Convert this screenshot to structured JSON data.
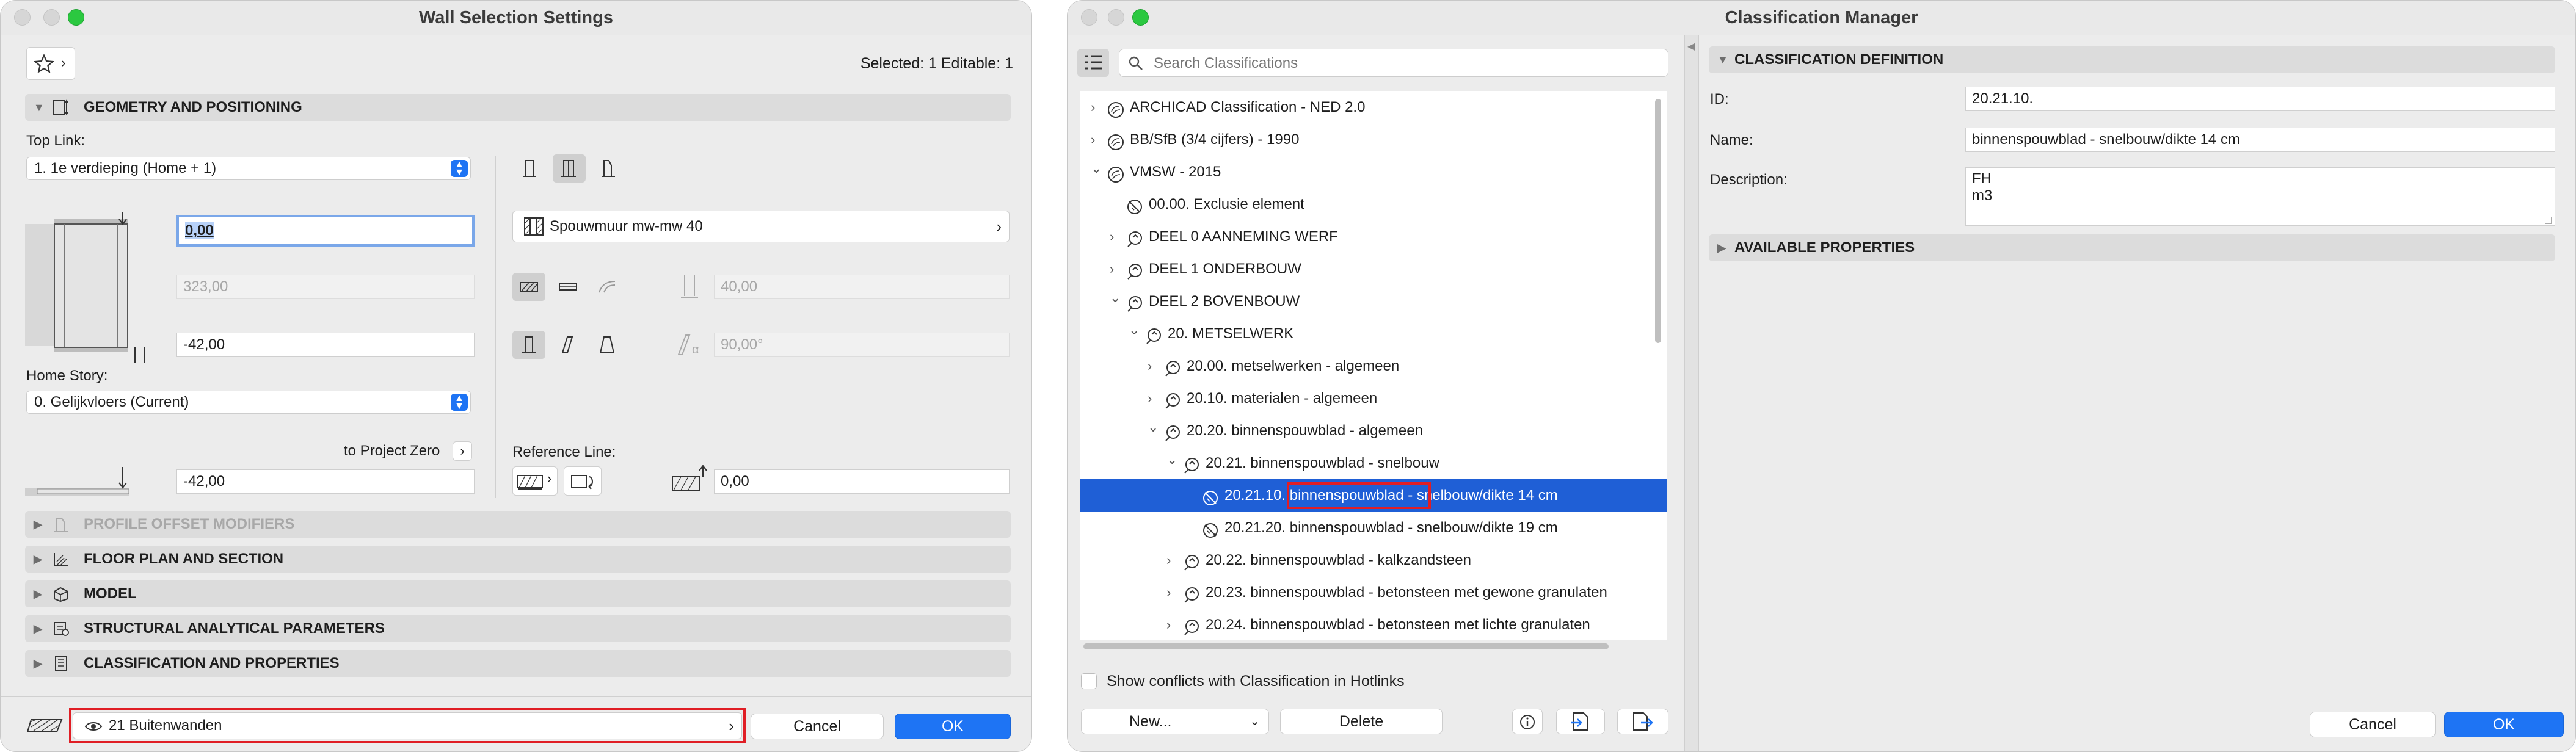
{
  "left_window": {
    "title": "Wall Selection Settings",
    "selection_info": "Selected: 1 Editable: 1",
    "favorites_icon": "star-icon",
    "geometry": {
      "header": "GEOMETRY AND POSITIONING",
      "top_link_label": "Top Link:",
      "top_link_value": "1. 1e verdieping (Home + 1)",
      "top_offset": "0,00",
      "height_value": "323,00",
      "bottom_offset": "-42,00",
      "home_story_label": "Home Story:",
      "home_story_value": "0. Gelijkvloers (Current)",
      "to_project_zero_label": "to Project Zero",
      "project_zero_value": "-42,00",
      "composite_name": "Spouwmuur mw-mw 40",
      "thickness_value": "40,00",
      "angle_value": "90,00°",
      "reference_line_label": "Reference Line:",
      "reference_offset": "0,00"
    },
    "sections": [
      {
        "label": "PROFILE OFFSET MODIFIERS",
        "enabled": false,
        "icon": "profile-icon"
      },
      {
        "label": "FLOOR PLAN AND SECTION",
        "enabled": true,
        "icon": "floor-plan-icon"
      },
      {
        "label": "MODEL",
        "enabled": true,
        "icon": "model-icon"
      },
      {
        "label": "STRUCTURAL ANALYTICAL PARAMETERS",
        "enabled": true,
        "icon": "structural-icon"
      },
      {
        "label": "CLASSIFICATION AND PROPERTIES",
        "enabled": true,
        "icon": "classification-icon"
      }
    ],
    "layer_value": "21 Buitenwanden",
    "cancel_label": "Cancel",
    "ok_label": "OK"
  },
  "right_window": {
    "title": "Classification Manager",
    "search_placeholder": "Search Classifications",
    "tree": [
      {
        "label": "ARCHICAD Classification - NED 2.0",
        "level": 0,
        "chevron": "right",
        "icon": "classification-system-icon"
      },
      {
        "label": "BB/SfB (3/4 cijfers) - 1990",
        "level": 0,
        "chevron": "right",
        "icon": "classification-system-icon"
      },
      {
        "label": "VMSW - 2015",
        "level": 0,
        "chevron": "down",
        "icon": "classification-system-icon"
      },
      {
        "label": "00.00. Exclusie element",
        "level": 1,
        "chevron": "none",
        "icon": "classification-leaf-icon"
      },
      {
        "label": "DEEL 0 AANNEMING WERF",
        "level": 1,
        "chevron": "right",
        "icon": "classification-item-icon"
      },
      {
        "label": "DEEL 1 ONDERBOUW",
        "level": 1,
        "chevron": "right",
        "icon": "classification-item-icon"
      },
      {
        "label": "DEEL 2 BOVENBOUW",
        "level": 1,
        "chevron": "down",
        "icon": "classification-item-icon"
      },
      {
        "label": "20. METSELWERK",
        "level": 2,
        "chevron": "down",
        "icon": "classification-item-icon"
      },
      {
        "label": "20.00. metselwerken - algemeen",
        "level": 3,
        "chevron": "right",
        "icon": "classification-item-icon"
      },
      {
        "label": "20.10. materialen - algemeen",
        "level": 3,
        "chevron": "right",
        "icon": "classification-item-icon"
      },
      {
        "label": "20.20. binnenspouwblad - algemeen",
        "level": 3,
        "chevron": "down",
        "icon": "classification-item-icon"
      },
      {
        "label": "20.21. binnenspouwblad - snelbouw",
        "level": 4,
        "chevron": "down",
        "icon": "classification-item-icon"
      },
      {
        "label": "20.21.10. binnenspouwblad - snelbouw/dikte 14 cm",
        "level": 5,
        "chevron": "none",
        "icon": "classification-leaf-icon",
        "selected": true
      },
      {
        "label": "20.21.20. binnenspouwblad - snelbouw/dikte 19 cm",
        "level": 5,
        "chevron": "none",
        "icon": "classification-leaf-icon"
      },
      {
        "label": "20.22. binnenspouwblad - kalkzandsteen",
        "level": 4,
        "chevron": "right",
        "icon": "classification-item-icon"
      },
      {
        "label": "20.23. binnenspouwblad - betonsteen met gewone granulaten",
        "level": 4,
        "chevron": "right",
        "icon": "classification-item-icon"
      },
      {
        "label": "20.24. binnenspouwblad - betonsteen met lichte granulaten",
        "level": 4,
        "chevron": "right",
        "icon": "classification-item-icon"
      }
    ],
    "conflicts_label": "Show conflicts with Classification in Hotlinks",
    "new_label": "New...",
    "delete_label": "Delete",
    "definition_header": "CLASSIFICATION DEFINITION",
    "id_label": "ID:",
    "id_value": "20.21.10.",
    "name_label": "Name:",
    "name_value": "binnenspouwblad - snelbouw/dikte 14 cm",
    "description_label": "Description:",
    "description_line1": "FH",
    "description_line2": "m3",
    "available_properties_header": "AVAILABLE PROPERTIES",
    "cancel_label": "Cancel",
    "ok_label": "OK"
  }
}
